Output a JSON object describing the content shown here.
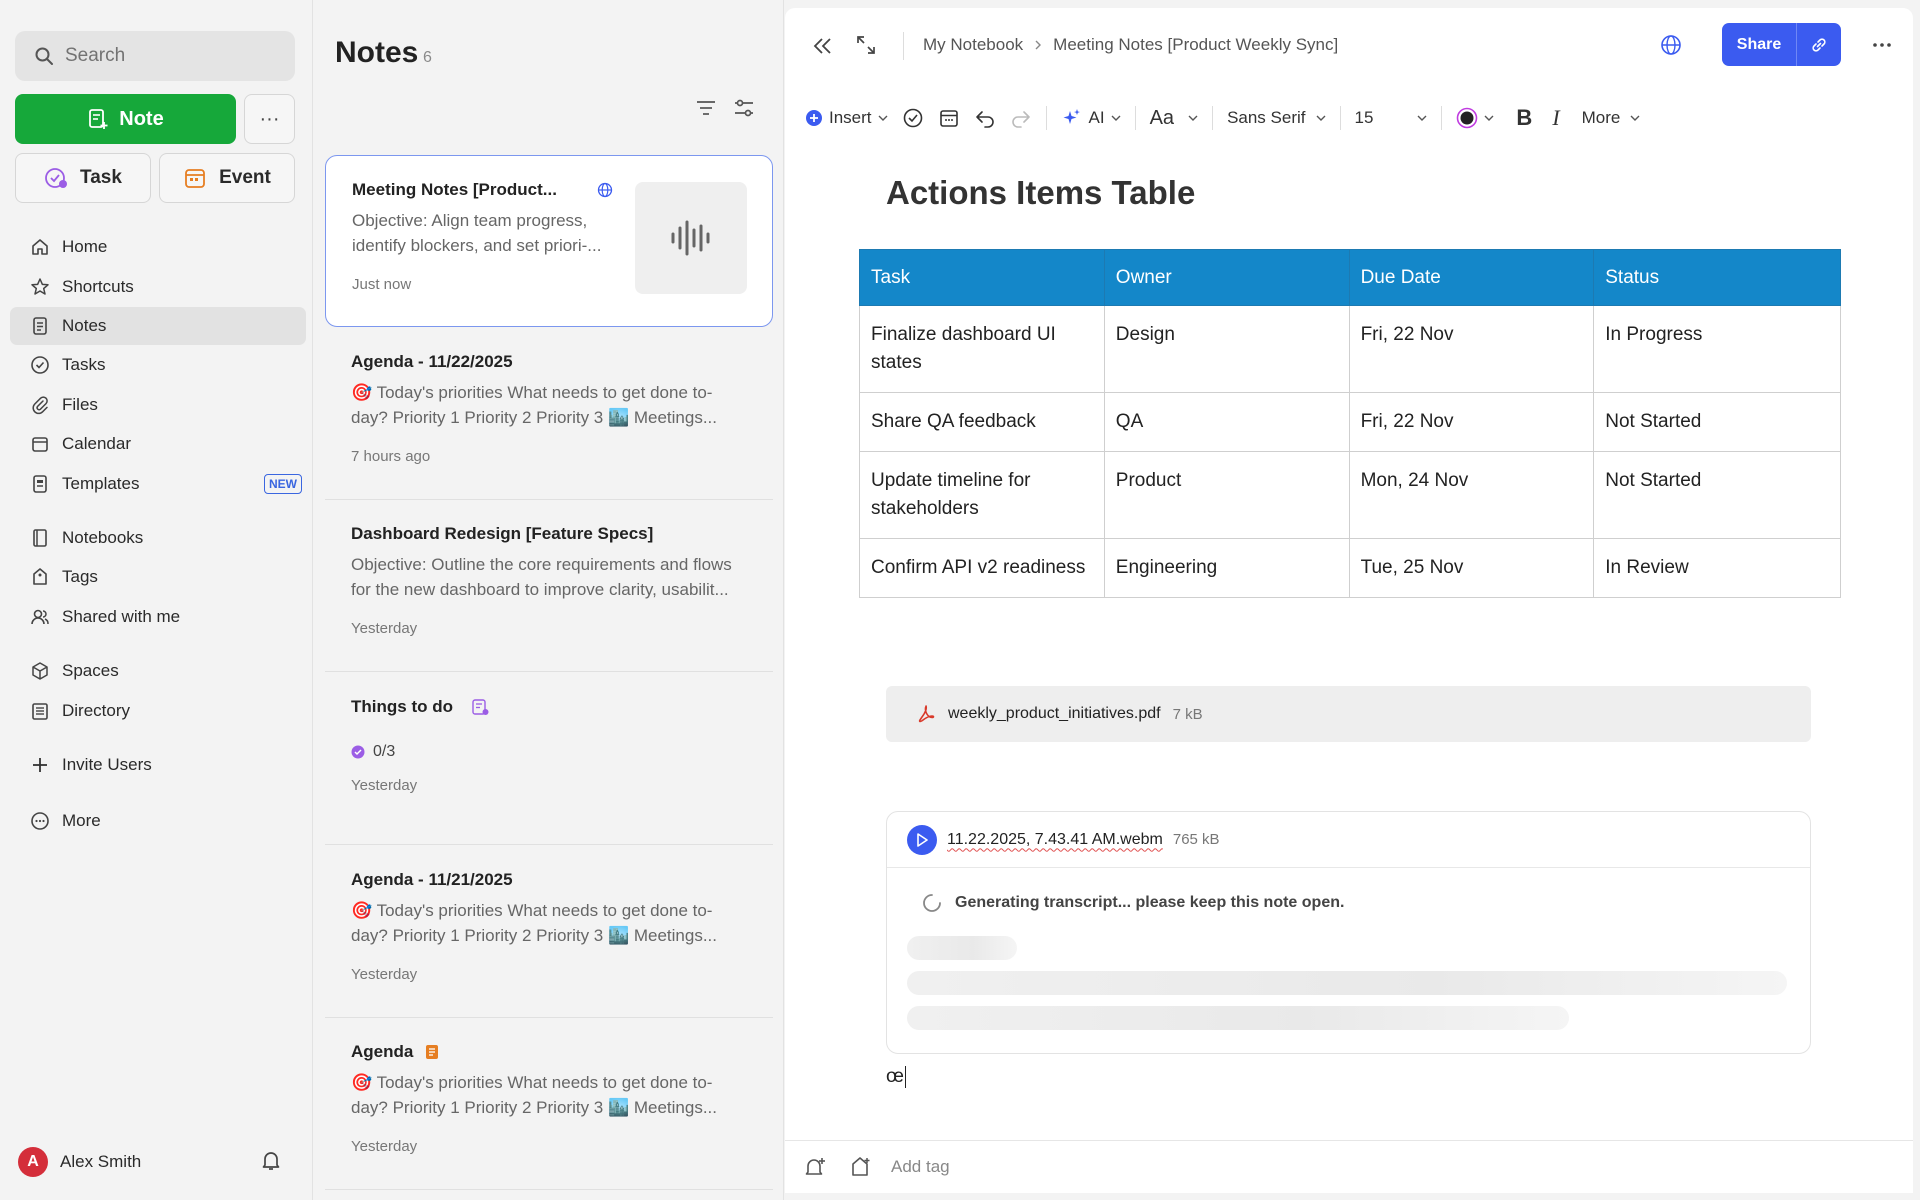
{
  "sidebar": {
    "search_placeholder": "Search",
    "note_button": "Note",
    "more_button": "···",
    "task_button": "Task",
    "event_button": "Event",
    "nav": [
      {
        "label": "Home"
      },
      {
        "label": "Shortcuts"
      },
      {
        "label": "Notes"
      },
      {
        "label": "Tasks"
      },
      {
        "label": "Files"
      },
      {
        "label": "Calendar"
      },
      {
        "label": "Templates",
        "badge": "NEW"
      },
      {
        "label": "Notebooks"
      },
      {
        "label": "Tags"
      },
      {
        "label": "Shared with me"
      },
      {
        "label": "Spaces"
      },
      {
        "label": "Directory"
      },
      {
        "label": "Invite Users"
      },
      {
        "label": "More"
      }
    ],
    "user": {
      "initial": "A",
      "name": "Alex Smith"
    }
  },
  "notes_list": {
    "title": "Notes",
    "count": "6",
    "items": [
      {
        "title": "Meeting Notes [Product...",
        "body": "Objective: Align team progress, identify blockers, and set priori-...",
        "time": "Just now"
      },
      {
        "title": "Agenda - 11/22/2025",
        "body": "🎯 Today's priorities What needs to get done to-day? Priority 1 Priority 2 Priority 3 🏙️ Meetings...",
        "time": "7 hours ago"
      },
      {
        "title": "Dashboard Redesign [Feature Specs]",
        "body": "Objective: Outline the core requirements and flows for the new dashboard to improve clarity, usabilit...",
        "time": "Yesterday"
      },
      {
        "title": "Things to do",
        "tasks": "0/3",
        "time": "Yesterday"
      },
      {
        "title": "Agenda - 11/21/2025",
        "body": "🎯 Today's priorities What needs to get done to-day? Priority 1 Priority 2 Priority 3 🏙️ Meetings...",
        "time": "Yesterday"
      },
      {
        "title": "Agenda",
        "body": "🎯 Today's priorities What needs to get done to-day? Priority 1 Priority 2 Priority 3 🏙️ Meetings...",
        "time": "Yesterday"
      }
    ]
  },
  "editor": {
    "breadcrumb": {
      "notebook": "My Notebook",
      "note": "Meeting Notes [Product Weekly Sync]"
    },
    "share_label": "Share",
    "toolbar": {
      "insert": "Insert",
      "ai": "AI",
      "text_style": "Aa",
      "font": "Sans Serif",
      "size": "15",
      "more": "More"
    },
    "doc_title": "Actions Items Table",
    "table": {
      "headers": [
        "Task",
        "Owner",
        "Due Date",
        "Status"
      ],
      "rows": [
        [
          "Finalize dashboard UI states",
          "Design",
          "Fri, 22 Nov",
          "In Progress"
        ],
        [
          "Share QA feedback",
          "QA",
          "Fri, 22 Nov",
          "Not Started"
        ],
        [
          "Update timeline for stakeholders",
          "Product",
          "Mon, 24 Nov",
          "Not Started"
        ],
        [
          "Confirm API v2 readiness",
          "Engineering",
          "Tue, 25 Nov",
          "In Review"
        ]
      ]
    },
    "attachment": {
      "name": "weekly_product_initiatives.pdf",
      "size": "7 kB"
    },
    "recording": {
      "name": "11.22.2025, 7.43.41 AM.webm",
      "size": "765 kB",
      "status": "Generating transcript... please keep this note open."
    },
    "typed_text": "œ",
    "footer": {
      "tag_placeholder": "Add tag"
    }
  },
  "colors": {
    "accent": "#3b5bf0",
    "note_green": "#16a83a",
    "table_header": "#1487c9"
  }
}
